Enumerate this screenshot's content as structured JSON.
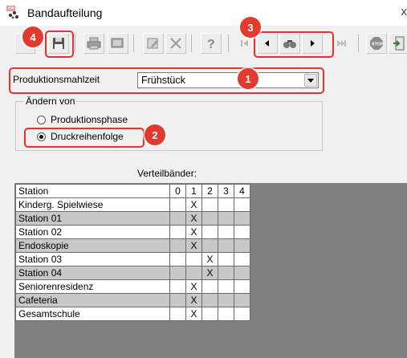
{
  "window": {
    "title": "Bandaufteilung",
    "close_glyph": "x"
  },
  "toolbar": {
    "icons": [
      "save-disk-icon",
      "print-icon",
      "preview-icon",
      "properties-icon",
      "delete-icon",
      "help-icon",
      "first-record-icon",
      "prev-record-icon",
      "find-icon",
      "next-record-icon",
      "last-record-icon",
      "stop-icon",
      "exit-icon"
    ]
  },
  "production_meal": {
    "label": "Produktionsmahlzeit",
    "value": "Frühstück"
  },
  "change_from": {
    "legend": "Ändern von",
    "options": [
      {
        "label": "Produktionsphase",
        "selected": false
      },
      {
        "label": "Druckreihenfolge",
        "selected": true
      }
    ]
  },
  "grid": {
    "caption": "Verteilbänder:",
    "columns": [
      "Station",
      "0",
      "1",
      "2",
      "3",
      "4"
    ],
    "rows": [
      {
        "name": "Kinderg. Spielwiese",
        "marks": [
          "",
          "X",
          "",
          "",
          ""
        ]
      },
      {
        "name": "Station 01",
        "marks": [
          "",
          "X",
          "",
          "",
          ""
        ]
      },
      {
        "name": "Station 02",
        "marks": [
          "",
          "X",
          "",
          "",
          ""
        ]
      },
      {
        "name": "Endoskopie",
        "marks": [
          "",
          "X",
          "",
          "",
          ""
        ]
      },
      {
        "name": "Station 03",
        "marks": [
          "",
          "",
          "X",
          "",
          ""
        ]
      },
      {
        "name": "Station 04",
        "marks": [
          "",
          "",
          "X",
          "",
          ""
        ]
      },
      {
        "name": "Seniorenresidenz",
        "marks": [
          "",
          "X",
          "",
          "",
          ""
        ]
      },
      {
        "name": "Cafeteria",
        "marks": [
          "",
          "X",
          "",
          "",
          ""
        ]
      },
      {
        "name": "Gesamtschule",
        "marks": [
          "",
          "X",
          "",
          "",
          ""
        ]
      }
    ]
  },
  "annotations": {
    "badge1": "1",
    "badge2": "2",
    "badge3": "3",
    "badge4": "4"
  },
  "colors": {
    "highlight": "#e8302c",
    "grid_alt_row": "#c8c8c8",
    "grid_bg": "#808080"
  }
}
